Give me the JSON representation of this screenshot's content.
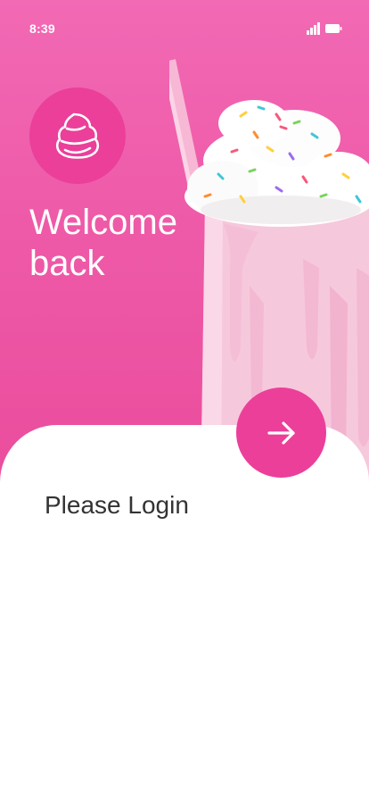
{
  "status_bar": {
    "time": "8:39",
    "signal_icon": "signal-bars-icon",
    "battery_icon": "battery-icon"
  },
  "hero": {
    "logo_icon": "whipped-cream-icon",
    "title": "Welcome back",
    "image": "strawberry-milkshake-photo"
  },
  "login": {
    "label": "Please Login",
    "next_icon": "arrow-right-icon"
  },
  "colors": {
    "primary": "#eb3f9a",
    "hero_background": "#f269b4",
    "text_dark": "#333333",
    "text_light": "#ffffff"
  }
}
